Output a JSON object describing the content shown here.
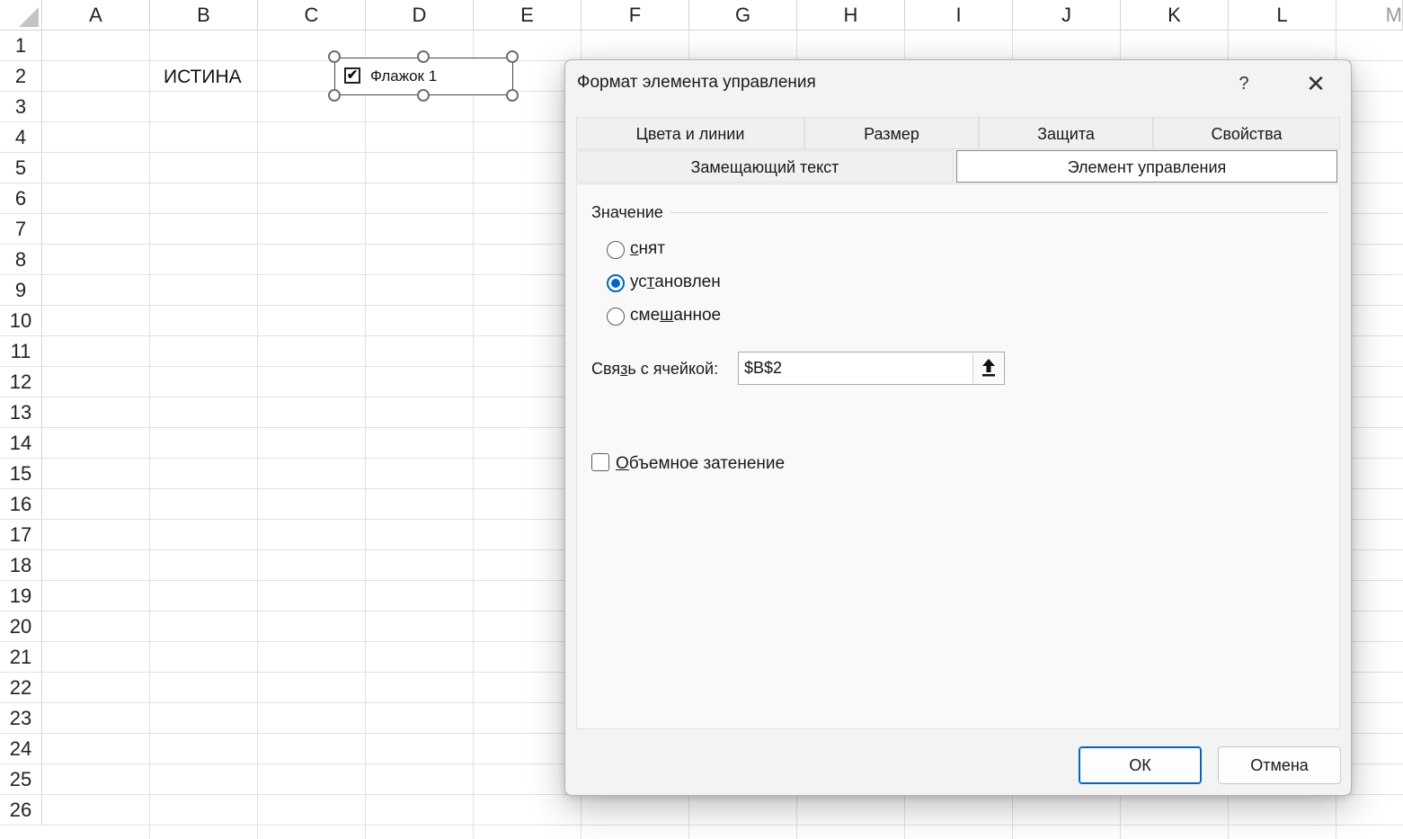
{
  "sheet": {
    "columns": [
      "A",
      "B",
      "C",
      "D",
      "E",
      "F",
      "G",
      "H",
      "I",
      "J",
      "K",
      "L",
      "M"
    ],
    "rows": [
      "1",
      "2",
      "3",
      "4",
      "5",
      "6",
      "7",
      "8",
      "9",
      "10",
      "11",
      "12",
      "13",
      "14",
      "15",
      "16",
      "17",
      "18",
      "19",
      "20",
      "21",
      "22",
      "23",
      "24",
      "25",
      "26"
    ],
    "cell_b2": "ИСТИНА",
    "checkbox_control": {
      "label": "Флажок 1",
      "checked": true
    }
  },
  "dialog": {
    "title": "Формат элемента управления",
    "help_label": "?",
    "close_label": "✕",
    "tabs_row1": [
      "Цвета и линии",
      "Размер",
      "Защита",
      "Свойства"
    ],
    "tabs_row2": [
      "Замещающий текст",
      "Элемент управления"
    ],
    "active_tab": "Элемент управления",
    "value_group": {
      "legend": "Значение",
      "options": [
        {
          "pre": "",
          "accel": "с",
          "post": "нят",
          "checked": false
        },
        {
          "pre": "ус",
          "accel": "т",
          "post": "ановлен",
          "checked": true
        },
        {
          "pre": "сме",
          "accel": "ш",
          "post": "анное",
          "checked": false
        }
      ]
    },
    "cell_link": {
      "pre": "Свя",
      "accel": "з",
      "post": "ь с ячейкой:",
      "value": "$B$2"
    },
    "shading": {
      "accel": "О",
      "post": "бъемное затенение",
      "checked": false
    },
    "ok_label": "ОК",
    "cancel_label": "Отмена"
  }
}
